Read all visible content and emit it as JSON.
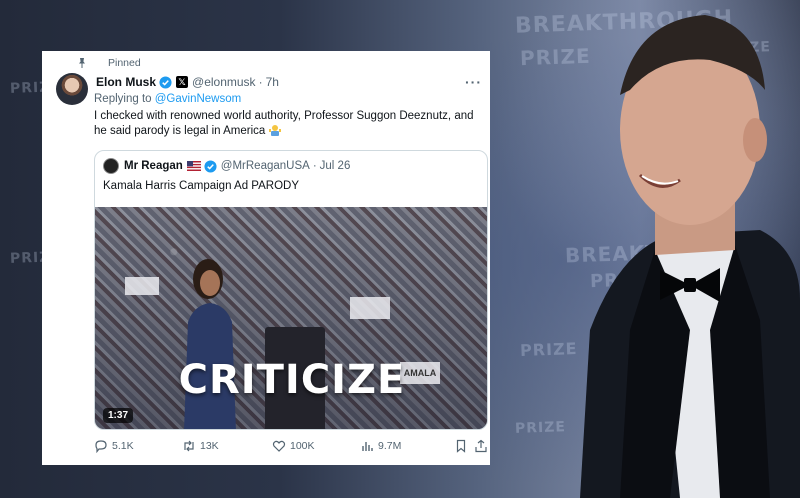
{
  "background": {
    "backdrop_words": [
      "BREAKTHROUGH",
      "PRIZE",
      "BREAKTHROUGH",
      "PRIZE",
      "PRIZE",
      "PRIZE",
      "PRIZE",
      "PRIZE",
      "PRIZE"
    ]
  },
  "tweet": {
    "pinned_label": "Pinned",
    "author_name": "Elon Musk",
    "author_handle": "@elonmusk",
    "time": "7h",
    "reply_prefix": "Replying to",
    "reply_to": "@GavinNewsom",
    "text": "I checked with renowned world authority, Professor Suggon Deeznutz, and he said parody is legal in America",
    "more_icon": "ellipsis-icon"
  },
  "quote": {
    "author_name": "Mr Reagan",
    "author_handle": "@MrReaganUSA",
    "date": "Jul 26",
    "text": "Kamala Harris Campaign Ad PARODY",
    "media": {
      "caption": "CRITICIZE",
      "duration": "1:37",
      "sign_text": "AMALA"
    }
  },
  "actions": {
    "replies": "5.1K",
    "retweets": "13K",
    "likes": "100K",
    "views": "9.7M"
  },
  "colors": {
    "link": "#1d9bf0",
    "secondary_text": "#536471",
    "primary_text": "#0f1419"
  }
}
